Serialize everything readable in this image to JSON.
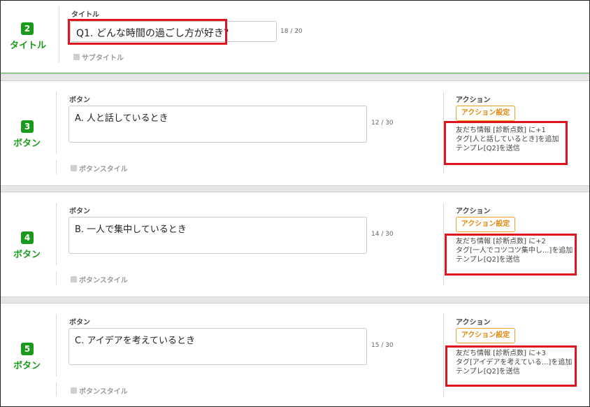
{
  "title_section": {
    "number": "2",
    "label": "タイトル",
    "field_label": "タイトル",
    "value": "Q1. どんな時間の過ごし方が好き？",
    "counter": "18 / 20",
    "subtitle_checkbox": "サブタイトル"
  },
  "button_sections": [
    {
      "number": "3",
      "label": "ボタン",
      "field_label": "ボタン",
      "value": "A. 人と話しているとき",
      "counter": "12 / 30",
      "style_checkbox": "ボタンスタイル",
      "action_label": "アクション",
      "action_button": "アクション設定",
      "action_lines": [
        "友だち情報 [診断点数] に+1",
        "タグ[人と話しているとき]を追加",
        "テンプレ[Q2]を送信"
      ]
    },
    {
      "number": "4",
      "label": "ボタン",
      "field_label": "ボタン",
      "value": "B. 一人で集中しているとき",
      "counter": "14 / 30",
      "style_checkbox": "ボタンスタイル",
      "action_label": "アクション",
      "action_button": "アクション設定",
      "action_lines": [
        "友だち情報 [診断点数] に+2",
        "タグ[一人でコツコツ集中し...]を追加",
        "テンプレ[Q2]を送信"
      ]
    },
    {
      "number": "5",
      "label": "ボタン",
      "field_label": "ボタン",
      "value": "C. アイデアを考えているとき",
      "counter": "15 / 30",
      "style_checkbox": "ボタンスタイル",
      "action_label": "アクション",
      "action_button": "アクション設定",
      "action_lines": [
        "友だち情報 [診断点数] に+3",
        "タグ[アイデアを考えている...]を追加",
        "テンプレ[Q2]を送信"
      ]
    }
  ],
  "colors": {
    "accent_green": "#1a9a1a",
    "highlight_red": "#e0141e",
    "action_orange": "#e08a10"
  }
}
